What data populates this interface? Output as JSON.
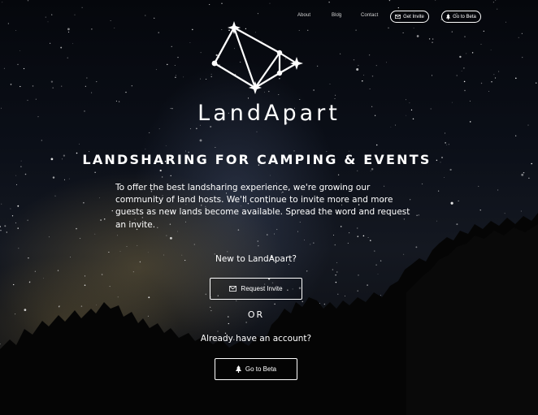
{
  "nav": {
    "links": [
      "About",
      "Blog",
      "Contact"
    ],
    "invite_button": "Get Invite",
    "beta_button": "Go to Beta"
  },
  "brand": {
    "name": "LandApart",
    "logo_icon": "constellation-tent-icon"
  },
  "hero": {
    "tagline": "LANDSHARING FOR CAMPING & EVENTS",
    "intro": "To offer the best landsharing experience, we're growing our community of land hosts. We'll continue to invite more and more guests as new lands become available. Spread the word and request an invite.",
    "new_label": "New to LandApart?",
    "request_button": "Request Invite",
    "or_label": "OR",
    "account_label": "Already have an account?",
    "beta_button": "Go to Beta"
  },
  "icons": {
    "envelope": "envelope-icon",
    "tree": "tree-icon"
  },
  "colors": {
    "text": "#ffffff",
    "sky": "#0b0f18",
    "milky_way_glow": "#706240"
  }
}
